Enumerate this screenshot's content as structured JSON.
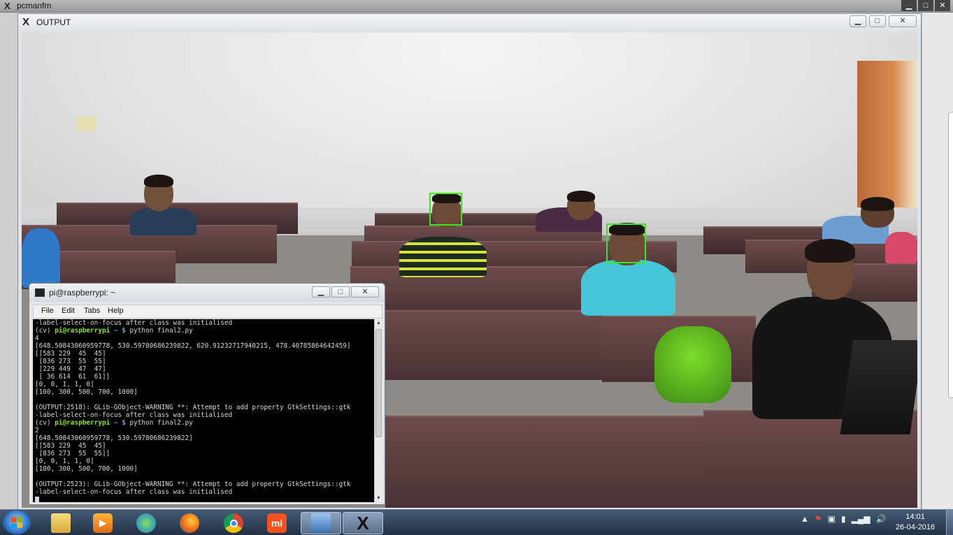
{
  "bg_window": {
    "title": "pcmanfm"
  },
  "output_window": {
    "title": "OUTPUT"
  },
  "terminal": {
    "title": "pi@raspberrypi: ~",
    "menu": [
      "File",
      "Edit",
      "Tabs",
      "Help"
    ],
    "lines": [
      [
        {
          "t": "-label-select-on-focus after class was initialised",
          "c": "plain"
        }
      ],
      [
        {
          "t": "(cv) ",
          "c": "env"
        },
        {
          "t": "pi@raspberrypi",
          "c": "host"
        },
        {
          "t": " ~ $ ",
          "c": "path"
        },
        {
          "t": "python final2.py",
          "c": "plain"
        }
      ],
      [
        {
          "t": "4",
          "c": "plain"
        }
      ],
      [
        {
          "t": "[648.50843060959778, 530.59780686239822, 620.91232717940215, 478.40785864642459]",
          "c": "plain"
        }
      ],
      [
        {
          "t": "[[583 229  45  45]",
          "c": "plain"
        }
      ],
      [
        {
          "t": " [836 273  55  55]",
          "c": "plain"
        }
      ],
      [
        {
          "t": " [229 449  47  47]",
          "c": "plain"
        }
      ],
      [
        {
          "t": " [ 36 614  61  61]]",
          "c": "plain"
        }
      ],
      [
        {
          "t": "[0, 0, 1, 1, 0]",
          "c": "plain"
        }
      ],
      [
        {
          "t": "[100, 300, 500, 700, 1000]",
          "c": "plain"
        }
      ],
      [
        {
          "t": "",
          "c": "plain"
        }
      ],
      [
        {
          "t": "(OUTPUT:2518): GLib-GObject-WARNING **: Attempt to add property GtkSettings::gtk",
          "c": "plain"
        }
      ],
      [
        {
          "t": "-label-select-on-focus after class was initialised",
          "c": "plain"
        }
      ],
      [
        {
          "t": "(cv) ",
          "c": "env"
        },
        {
          "t": "pi@raspberrypi",
          "c": "host"
        },
        {
          "t": " ~ $ ",
          "c": "path"
        },
        {
          "t": "python final2.py",
          "c": "plain"
        }
      ],
      [
        {
          "t": "2",
          "c": "plain"
        }
      ],
      [
        {
          "t": "[648.50843060959778, 530.59780686239822]",
          "c": "plain"
        }
      ],
      [
        {
          "t": "[[583 229  45  45]",
          "c": "plain"
        }
      ],
      [
        {
          "t": " [836 273  55  55]]",
          "c": "plain"
        }
      ],
      [
        {
          "t": "[0, 0, 1, 1, 0]",
          "c": "plain"
        }
      ],
      [
        {
          "t": "[100, 300, 500, 700, 1000]",
          "c": "plain"
        }
      ],
      [
        {
          "t": "",
          "c": "plain"
        }
      ],
      [
        {
          "t": "(OUTPUT:2523): GLib-GObject-WARNING **: Attempt to add property GtkSettings::gtk",
          "c": "plain"
        }
      ],
      [
        {
          "t": "-label-select-on-focus after class was initialised",
          "c": "plain"
        }
      ]
    ]
  },
  "taskbar": {
    "apps": [
      "folder-icon",
      "media-player-icon",
      "network-globe-icon",
      "firefox-icon",
      "chrome-icon",
      "mi-icon",
      "remote-desktop-icon",
      "x-server-icon"
    ],
    "mi_label": "mi",
    "clock_time": "14:01",
    "clock_date": "26-04-2016"
  },
  "colors": {
    "face_box": "#39e81a",
    "terminal_bg": "#000000",
    "prompt_host": "#8ae234",
    "prompt_path": "#729fcf"
  }
}
